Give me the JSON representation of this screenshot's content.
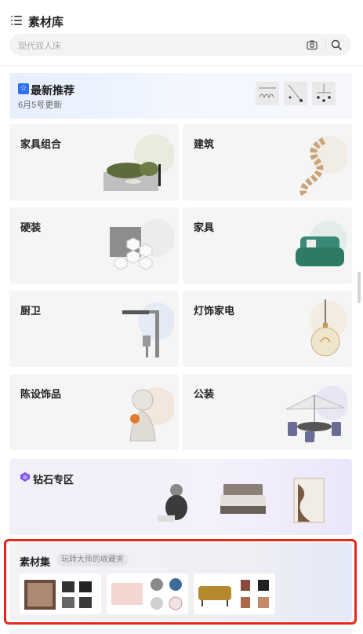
{
  "header": {
    "title": "素材库",
    "search_placeholder": "现代双人床"
  },
  "banner": {
    "badge": "☆",
    "title": "最新推荐",
    "subtitle": "6月5号更新"
  },
  "categories": [
    {
      "label": "家具组合"
    },
    {
      "label": "建筑"
    },
    {
      "label": "硬装"
    },
    {
      "label": "家具"
    },
    {
      "label": "厨卫"
    },
    {
      "label": "灯饰家电"
    },
    {
      "label": "陈设饰品"
    },
    {
      "label": "公装"
    }
  ],
  "diamond": {
    "label": "钻石专区"
  },
  "collection": {
    "title": "素材集",
    "tag": "玩转大师的收藏夹"
  },
  "colors": {
    "accent_blue": "#2f6ff0",
    "highlight_red": "#e8261c",
    "gem_purple": "#7c4ff0"
  }
}
